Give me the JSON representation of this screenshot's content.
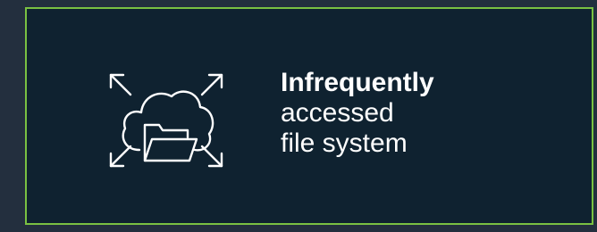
{
  "card": {
    "border_color": "#7ac142",
    "background_color": "#0f2230",
    "icon": "cloud-folder-expand-icon",
    "label": {
      "line1": "Infrequently",
      "line2": "accessed",
      "line3": "file system"
    }
  }
}
